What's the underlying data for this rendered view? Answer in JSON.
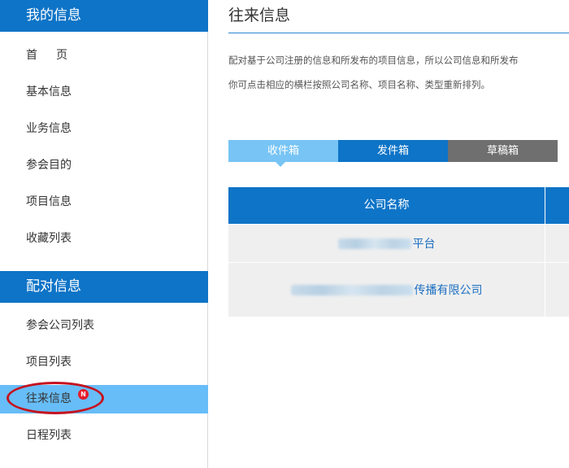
{
  "sidebar": {
    "sections": [
      {
        "title": "我的信息",
        "items": [
          "首页",
          "基本信息",
          "业务信息",
          "参会目的",
          "项目信息",
          "收藏列表"
        ]
      },
      {
        "title": "配对信息",
        "items": [
          "参会公司列表",
          "项目列表",
          "往来信息",
          "日程列表"
        ]
      }
    ],
    "active_item": "往来信息",
    "badge_text": "N"
  },
  "main": {
    "title": "往来信息",
    "desc_line1": "配对基于公司注册的信息和所发布的项目信息，所以公司信息和所发布",
    "desc_line2": "你可点击相应的横栏按照公司名称、项目名称、类型重新排列。",
    "tabs": [
      "收件箱",
      "发件箱",
      "草稿箱"
    ],
    "table": {
      "headers": [
        "公司名称"
      ],
      "rows": [
        {
          "company_visible": "平台"
        },
        {
          "company_visible": "传播有限公司"
        }
      ]
    }
  },
  "colors": {
    "primary": "#0e74c7",
    "active_item": "#67bdf7",
    "tab_inbox": "#77c4f5",
    "tab_drafts": "#6f6f6f",
    "row_bg": "#efefef",
    "link": "#1d6fc2",
    "badge": "#e51d2a",
    "annotation_circle": "#c5131f"
  }
}
